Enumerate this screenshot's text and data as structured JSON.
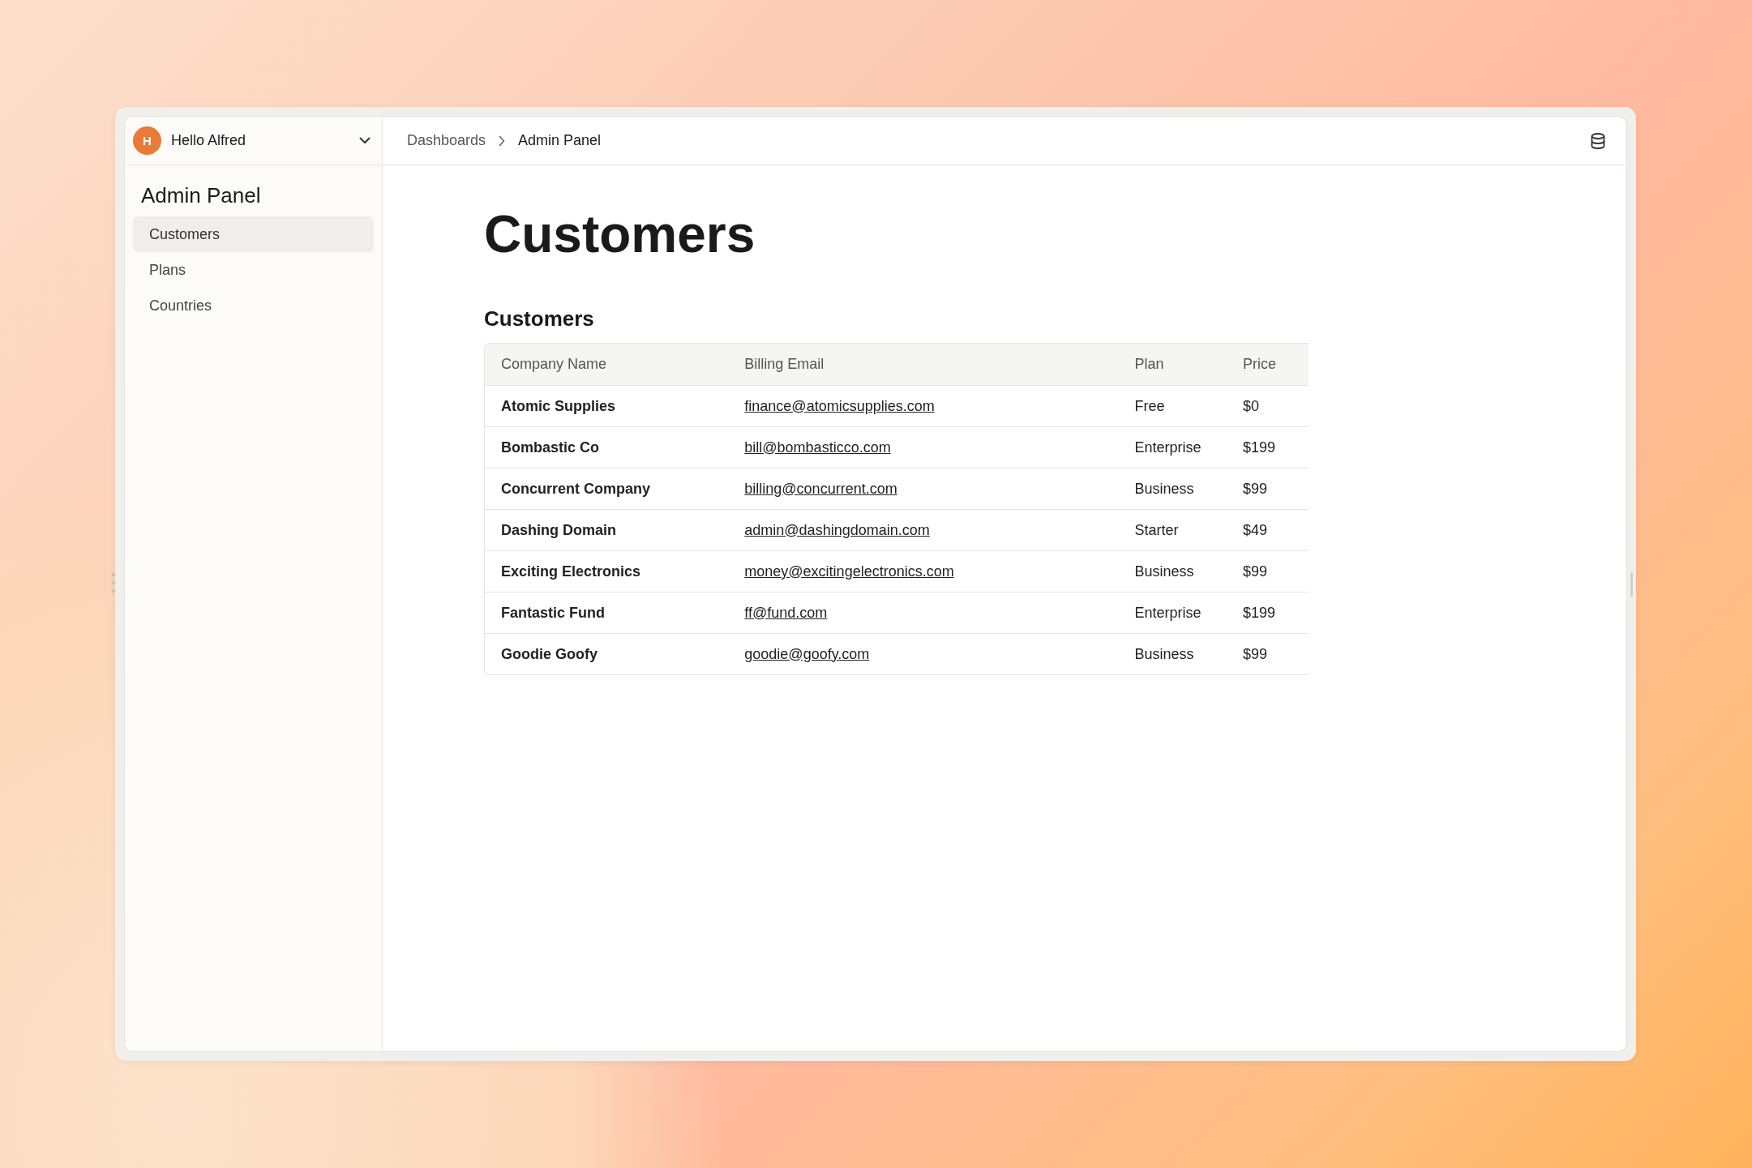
{
  "account": {
    "avatar_letter": "H",
    "greeting": "Hello Alfred"
  },
  "breadcrumbs": [
    "Dashboards",
    "Admin Panel"
  ],
  "sidebar": {
    "title": "Admin Panel",
    "items": [
      {
        "label": "Customers",
        "selected": true
      },
      {
        "label": "Plans",
        "selected": false
      },
      {
        "label": "Countries",
        "selected": false
      }
    ]
  },
  "page_title": "Customers",
  "section_title": "Customers",
  "table": {
    "columns": [
      "Company Name",
      "Billing Email",
      "Plan",
      "Price"
    ],
    "rows": [
      {
        "company": "Atomic Supplies",
        "email": "finance@atomicsupplies.com",
        "plan": "Free",
        "price": "$0"
      },
      {
        "company": "Bombastic Co",
        "email": "bill@bombasticco.com",
        "plan": "Enterprise",
        "price": "$199"
      },
      {
        "company": "Concurrent Company",
        "email": "billing@concurrent.com",
        "plan": "Business",
        "price": "$99"
      },
      {
        "company": "Dashing Domain",
        "email": "admin@dashingdomain.com",
        "plan": "Starter",
        "price": "$49"
      },
      {
        "company": "Exciting Electronics",
        "email": "money@excitingelectronics.com",
        "plan": "Business",
        "price": "$99"
      },
      {
        "company": "Fantastic Fund",
        "email": "ff@fund.com",
        "plan": "Enterprise",
        "price": "$199"
      },
      {
        "company": "Goodie Goofy",
        "email": "goodie@goofy.com",
        "plan": "Business",
        "price": "$99"
      }
    ]
  }
}
